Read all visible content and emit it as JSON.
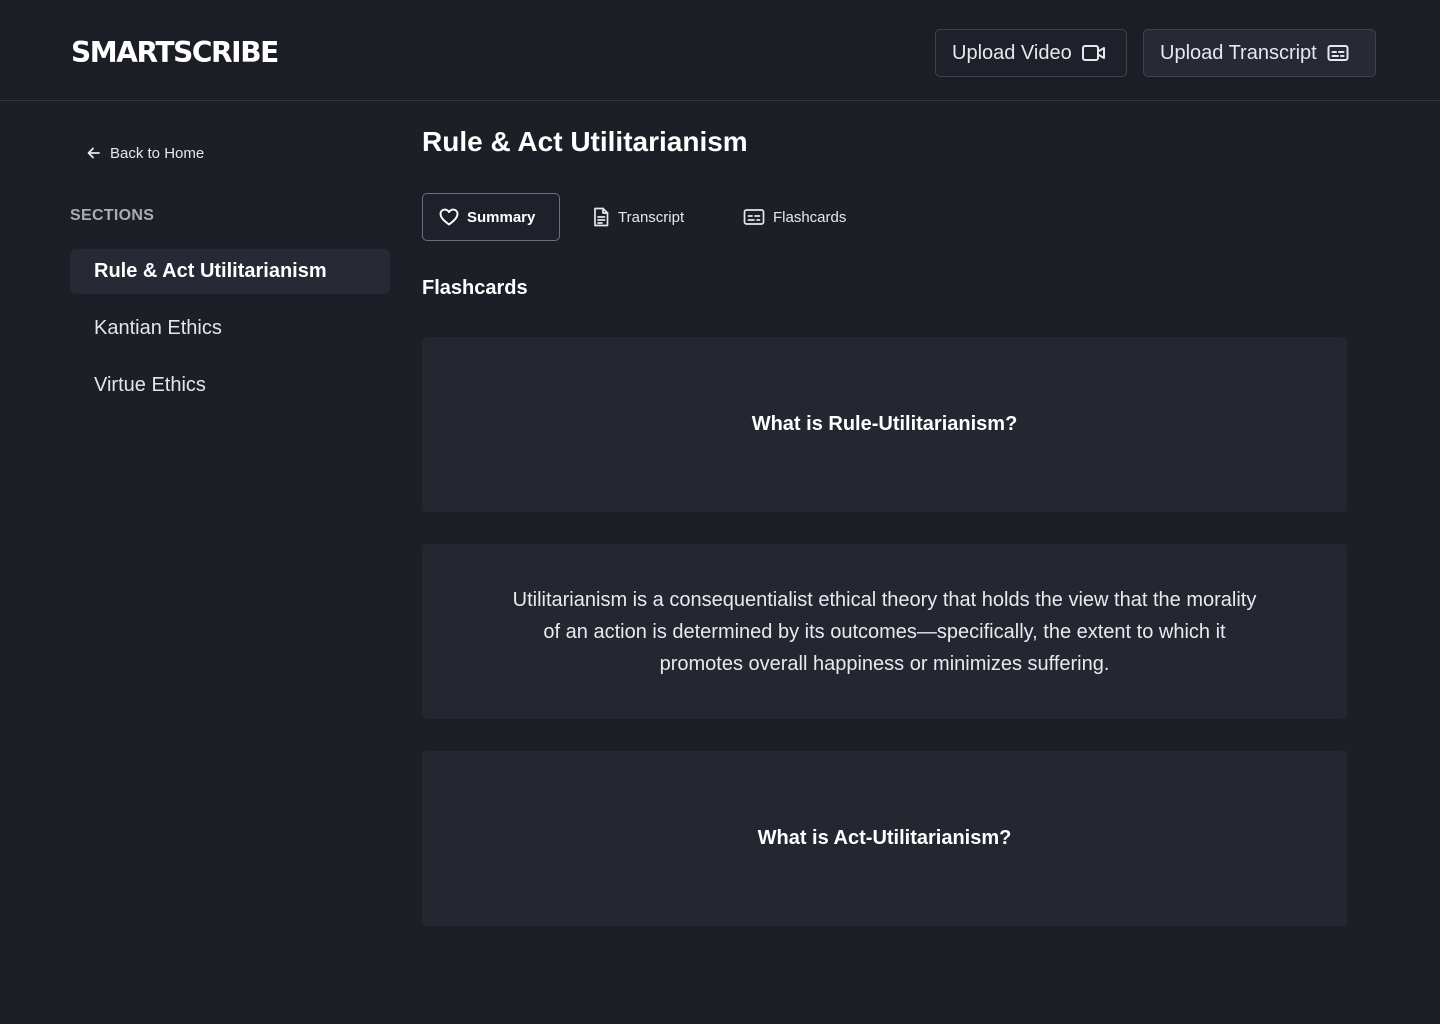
{
  "header": {
    "logo": "SMARTSCRIBE",
    "upload_video_label": "Upload Video",
    "upload_transcript_label": "Upload Transcript"
  },
  "sidebar": {
    "back_label": "Back to Home",
    "sections_title": "SECTIONS",
    "items": [
      {
        "label": "Rule & Act Utilitarianism",
        "active": true
      },
      {
        "label": "Kantian Ethics",
        "active": false
      },
      {
        "label": "Virtue Ethics",
        "active": false
      }
    ]
  },
  "main": {
    "title": "Rule & Act Utilitarianism",
    "tabs": [
      {
        "label": "Summary",
        "icon": "heart-icon",
        "active": true
      },
      {
        "label": "Transcript",
        "icon": "document-icon",
        "active": false
      },
      {
        "label": "Flashcards",
        "icon": "flashcards-icon",
        "active": false
      }
    ],
    "section_heading": "Flashcards",
    "cards": [
      {
        "text": "What is Rule-Utilitarianism?",
        "kind": "question"
      },
      {
        "text": "Utilitarianism is a consequentialist ethical theory that holds the view that the morality of an action is determined by its outcomes—specifically, the extent to which it promotes overall happiness or minimizes suffering.",
        "kind": "answer"
      },
      {
        "text": "What is Act-Utilitarianism?",
        "kind": "question"
      }
    ]
  },
  "colors": {
    "background": "#1d1f27",
    "card": "#242730",
    "active_item": "#272a34",
    "border": "#40434e"
  }
}
